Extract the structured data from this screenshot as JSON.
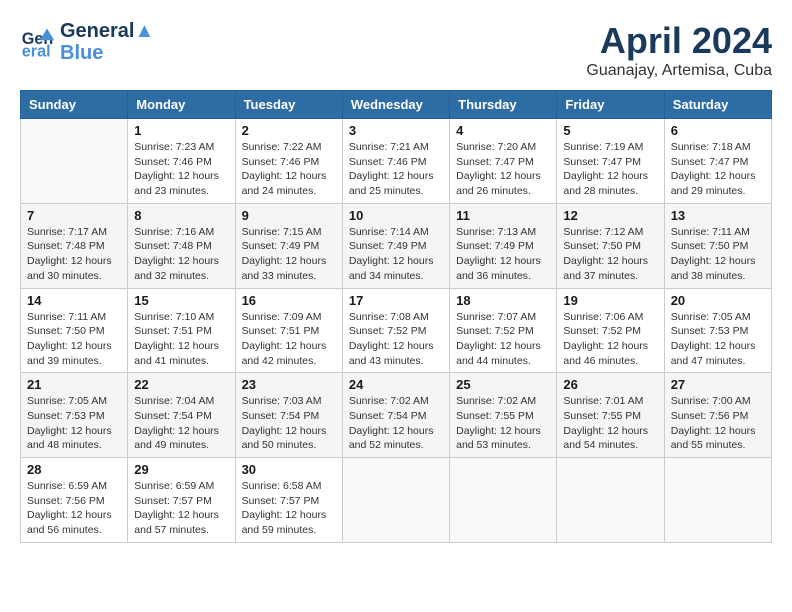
{
  "header": {
    "logo_line1": "General",
    "logo_line2": "Blue",
    "month_title": "April 2024",
    "subtitle": "Guanajay, Artemisa, Cuba"
  },
  "weekdays": [
    "Sunday",
    "Monday",
    "Tuesday",
    "Wednesday",
    "Thursday",
    "Friday",
    "Saturday"
  ],
  "weeks": [
    [
      {
        "day": "",
        "info": ""
      },
      {
        "day": "1",
        "info": "Sunrise: 7:23 AM\nSunset: 7:46 PM\nDaylight: 12 hours\nand 23 minutes."
      },
      {
        "day": "2",
        "info": "Sunrise: 7:22 AM\nSunset: 7:46 PM\nDaylight: 12 hours\nand 24 minutes."
      },
      {
        "day": "3",
        "info": "Sunrise: 7:21 AM\nSunset: 7:46 PM\nDaylight: 12 hours\nand 25 minutes."
      },
      {
        "day": "4",
        "info": "Sunrise: 7:20 AM\nSunset: 7:47 PM\nDaylight: 12 hours\nand 26 minutes."
      },
      {
        "day": "5",
        "info": "Sunrise: 7:19 AM\nSunset: 7:47 PM\nDaylight: 12 hours\nand 28 minutes."
      },
      {
        "day": "6",
        "info": "Sunrise: 7:18 AM\nSunset: 7:47 PM\nDaylight: 12 hours\nand 29 minutes."
      }
    ],
    [
      {
        "day": "7",
        "info": "Sunrise: 7:17 AM\nSunset: 7:48 PM\nDaylight: 12 hours\nand 30 minutes."
      },
      {
        "day": "8",
        "info": "Sunrise: 7:16 AM\nSunset: 7:48 PM\nDaylight: 12 hours\nand 32 minutes."
      },
      {
        "day": "9",
        "info": "Sunrise: 7:15 AM\nSunset: 7:49 PM\nDaylight: 12 hours\nand 33 minutes."
      },
      {
        "day": "10",
        "info": "Sunrise: 7:14 AM\nSunset: 7:49 PM\nDaylight: 12 hours\nand 34 minutes."
      },
      {
        "day": "11",
        "info": "Sunrise: 7:13 AM\nSunset: 7:49 PM\nDaylight: 12 hours\nand 36 minutes."
      },
      {
        "day": "12",
        "info": "Sunrise: 7:12 AM\nSunset: 7:50 PM\nDaylight: 12 hours\nand 37 minutes."
      },
      {
        "day": "13",
        "info": "Sunrise: 7:11 AM\nSunset: 7:50 PM\nDaylight: 12 hours\nand 38 minutes."
      }
    ],
    [
      {
        "day": "14",
        "info": "Sunrise: 7:11 AM\nSunset: 7:50 PM\nDaylight: 12 hours\nand 39 minutes."
      },
      {
        "day": "15",
        "info": "Sunrise: 7:10 AM\nSunset: 7:51 PM\nDaylight: 12 hours\nand 41 minutes."
      },
      {
        "day": "16",
        "info": "Sunrise: 7:09 AM\nSunset: 7:51 PM\nDaylight: 12 hours\nand 42 minutes."
      },
      {
        "day": "17",
        "info": "Sunrise: 7:08 AM\nSunset: 7:52 PM\nDaylight: 12 hours\nand 43 minutes."
      },
      {
        "day": "18",
        "info": "Sunrise: 7:07 AM\nSunset: 7:52 PM\nDaylight: 12 hours\nand 44 minutes."
      },
      {
        "day": "19",
        "info": "Sunrise: 7:06 AM\nSunset: 7:52 PM\nDaylight: 12 hours\nand 46 minutes."
      },
      {
        "day": "20",
        "info": "Sunrise: 7:05 AM\nSunset: 7:53 PM\nDaylight: 12 hours\nand 47 minutes."
      }
    ],
    [
      {
        "day": "21",
        "info": "Sunrise: 7:05 AM\nSunset: 7:53 PM\nDaylight: 12 hours\nand 48 minutes."
      },
      {
        "day": "22",
        "info": "Sunrise: 7:04 AM\nSunset: 7:54 PM\nDaylight: 12 hours\nand 49 minutes."
      },
      {
        "day": "23",
        "info": "Sunrise: 7:03 AM\nSunset: 7:54 PM\nDaylight: 12 hours\nand 50 minutes."
      },
      {
        "day": "24",
        "info": "Sunrise: 7:02 AM\nSunset: 7:54 PM\nDaylight: 12 hours\nand 52 minutes."
      },
      {
        "day": "25",
        "info": "Sunrise: 7:02 AM\nSunset: 7:55 PM\nDaylight: 12 hours\nand 53 minutes."
      },
      {
        "day": "26",
        "info": "Sunrise: 7:01 AM\nSunset: 7:55 PM\nDaylight: 12 hours\nand 54 minutes."
      },
      {
        "day": "27",
        "info": "Sunrise: 7:00 AM\nSunset: 7:56 PM\nDaylight: 12 hours\nand 55 minutes."
      }
    ],
    [
      {
        "day": "28",
        "info": "Sunrise: 6:59 AM\nSunset: 7:56 PM\nDaylight: 12 hours\nand 56 minutes."
      },
      {
        "day": "29",
        "info": "Sunrise: 6:59 AM\nSunset: 7:57 PM\nDaylight: 12 hours\nand 57 minutes."
      },
      {
        "day": "30",
        "info": "Sunrise: 6:58 AM\nSunset: 7:57 PM\nDaylight: 12 hours\nand 59 minutes."
      },
      {
        "day": "",
        "info": ""
      },
      {
        "day": "",
        "info": ""
      },
      {
        "day": "",
        "info": ""
      },
      {
        "day": "",
        "info": ""
      }
    ]
  ]
}
